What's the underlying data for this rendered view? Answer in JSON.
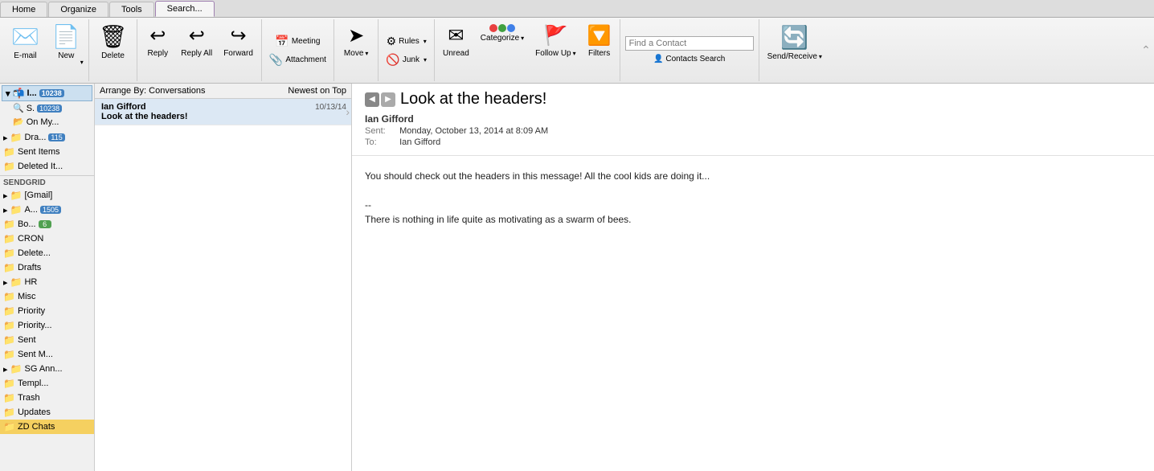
{
  "tabs": [
    {
      "label": "Home",
      "active": false
    },
    {
      "label": "Organize",
      "active": false
    },
    {
      "label": "Tools",
      "active": false
    },
    {
      "label": "Search...",
      "active": true
    }
  ],
  "ribbon": {
    "email_label": "E-mail",
    "new_label": "New",
    "delete_label": "Delete",
    "reply_label": "Reply",
    "reply_all_label": "Reply All",
    "forward_label": "Forward",
    "meeting_label": "Meeting",
    "attachment_label": "Attachment",
    "move_label": "Move",
    "rules_label": "Rules",
    "junk_label": "Junk",
    "unread_label": "Unread",
    "categorize_label": "Categorize",
    "follow_up_label": "Follow Up",
    "filters_label": "Filters",
    "find_contact_placeholder": "Find a Contact",
    "contacts_search_label": "Contacts Search",
    "send_receive_label": "Send/Receive"
  },
  "sidebar": {
    "inbox_label": "I...",
    "inbox_badge": "10238",
    "search_label": "S.",
    "search_badge": "10238",
    "on_my_label": "On My...",
    "drafts_label": "Dra...",
    "drafts_badge": "115",
    "sent_items_label": "Sent Items",
    "deleted_label": "Deleted It...",
    "sendgrid_label": "SENDGRID",
    "gmail_label": "[Gmail]",
    "a_label": "A...",
    "a_badge": "1505",
    "bo_label": "Bo...",
    "bo_badge": "6",
    "cron_label": "CRON",
    "delete2_label": "Delete...",
    "drafts2_label": "Drafts",
    "hr_label": "HR",
    "misc_label": "Misc",
    "priority_label": "Priority",
    "priority2_label": "Priority...",
    "sent_label": "Sent",
    "sent_m_label": "Sent M...",
    "sg_ann_label": "SG Ann...",
    "templ_label": "Templ...",
    "trash_label": "Trash",
    "updates_label": "Updates",
    "zd_chats_label": "ZD Chats"
  },
  "email_list": {
    "arrange_label": "Arrange By: Conversations",
    "sort_label": "Newest on Top",
    "item": {
      "subject": "Look at the headers!",
      "sender": "Ian Gifford",
      "date": "10/13/14"
    }
  },
  "email": {
    "title": "Look at the headers!",
    "from": "Ian Gifford",
    "sent": "Monday, October 13, 2014 at 8:09 AM",
    "to": "Ian Gifford",
    "body_line1": "You should check out the headers in this message! All the cool kids are doing it...",
    "body_line2": "--",
    "body_line3": "There is nothing in life quite as motivating as a swarm of bees."
  },
  "icons": {
    "email": "✉",
    "new_items": "📋",
    "delete": "🗑",
    "reply": "↩",
    "reply_all": "↩↩",
    "forward": "↪",
    "meeting": "📅",
    "attachment": "📎",
    "move": "➤",
    "rules": "⚙",
    "junk": "🚫",
    "unread": "✉",
    "categorize": "🏷",
    "follow_up": "🚩",
    "filters": "🔽",
    "contacts_search": "👤",
    "send_receive": "🔄",
    "folder": "📁",
    "nav_back": "◀",
    "nav_fwd": "▶",
    "chevron_down": "▾",
    "chevron_right": "▸",
    "chevron_left": "◂"
  }
}
